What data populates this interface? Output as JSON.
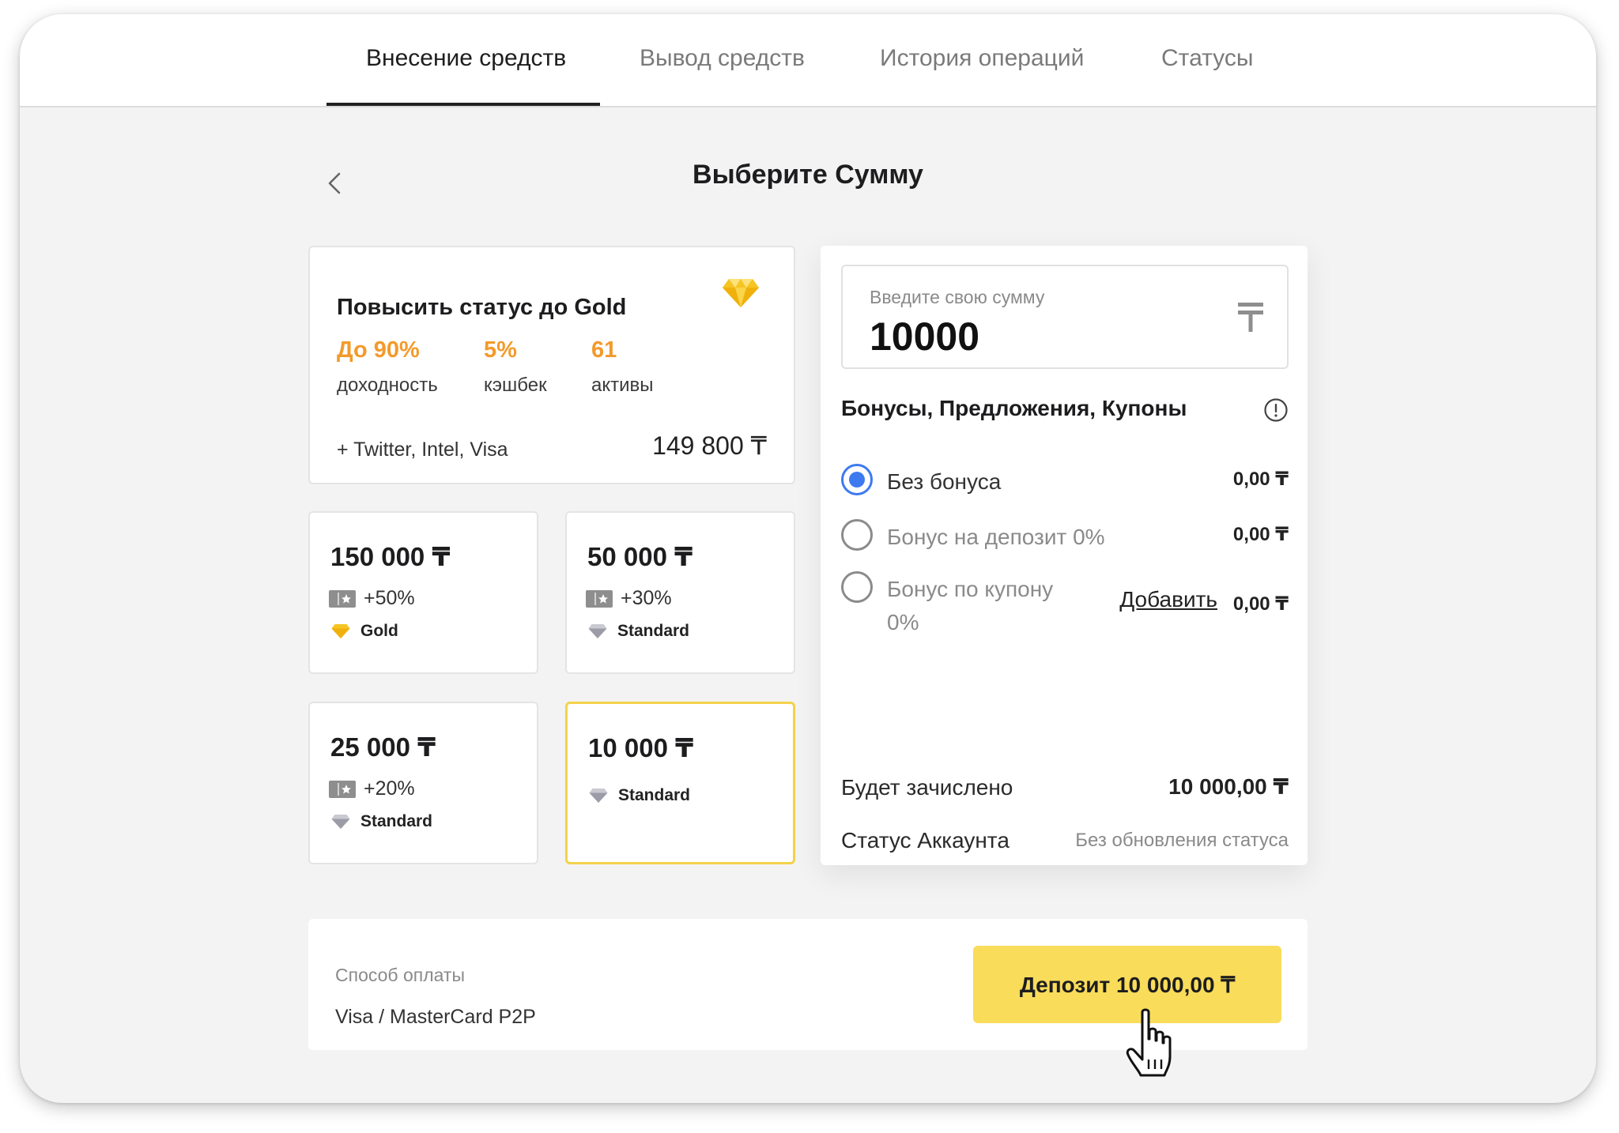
{
  "tabs": [
    {
      "label": "Внесение средств",
      "active": true
    },
    {
      "label": "Вывод средств",
      "active": false
    },
    {
      "label": "История операций",
      "active": false
    },
    {
      "label": "Статусы",
      "active": false
    }
  ],
  "page_title": "Выберите Сумму",
  "upgrade": {
    "title": "Повысить статус до Gold",
    "stats": [
      {
        "value": "До 90%",
        "label": "доходность"
      },
      {
        "value": "5%",
        "label": "кэшбек"
      },
      {
        "value": "61",
        "label": "активы"
      }
    ],
    "assets": "+ Twitter, Intel, Visa",
    "price": "149 800 ₸"
  },
  "amounts": [
    {
      "amount": "150 000 ₸",
      "bonus": "+50%",
      "tier": "Gold",
      "selected": false
    },
    {
      "amount": "50 000 ₸",
      "bonus": "+30%",
      "tier": "Standard",
      "selected": false
    },
    {
      "amount": "25 000 ₸",
      "bonus": "+20%",
      "tier": "Standard",
      "selected": false
    },
    {
      "amount": "10 000 ₸",
      "bonus": "",
      "tier": "Standard",
      "selected": true
    }
  ],
  "amount_input": {
    "placeholder": "Введите свою сумму",
    "value": "10000"
  },
  "bonuses": {
    "title": "Бонусы, Предложения, Купоны",
    "options": [
      {
        "label": "Без бонуса",
        "value": "0,00 ₸",
        "checked": true
      },
      {
        "label": "Бонус на депозит 0%",
        "value": "0,00 ₸",
        "checked": false
      },
      {
        "label_line1": "Бонус по купону",
        "label_line2": "0%",
        "value": "0,00 ₸",
        "checked": false,
        "action": "Добавить"
      }
    ]
  },
  "summary": {
    "credited_label": "Будет зачислено",
    "credited_value": "10 000,00 ₸",
    "status_label": "Статус Аккаунта",
    "status_value": "Без обновления статуса"
  },
  "payment": {
    "label": "Способ оплаты",
    "method": "Visa / MasterCard P2P",
    "button": "Депозит 10 000,00 ₸"
  },
  "colors": {
    "accent_yellow": "#f9dc5a",
    "stat_orange": "#f39a2a",
    "radio_blue": "#3d7af0",
    "selected_border": "#f3d24a"
  }
}
